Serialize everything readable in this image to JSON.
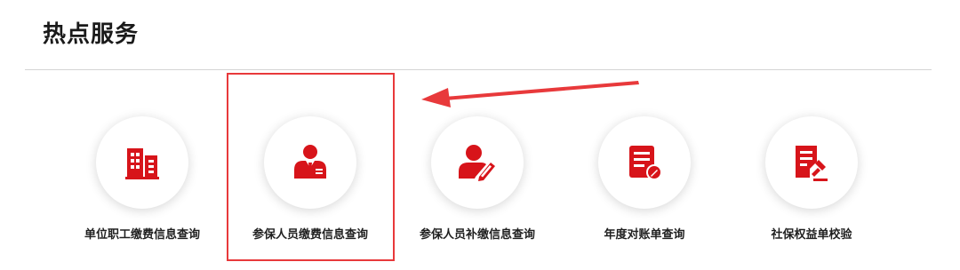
{
  "section": {
    "title": "热点服务"
  },
  "services": [
    {
      "label": "单位职工缴费信息查询",
      "icon": "buildings-icon"
    },
    {
      "label": "参保人员缴费信息查询",
      "icon": "person-id-icon"
    },
    {
      "label": "参保人员补缴信息查询",
      "icon": "person-edit-icon"
    },
    {
      "label": "年度对账单查询",
      "icon": "document-edit-icon"
    },
    {
      "label": "社保权益单校验",
      "icon": "document-stamp-icon"
    }
  ],
  "colors": {
    "accent": "#d7141a",
    "annotation": "#e8393b",
    "divider": "#d4d4d4",
    "title": "#1a1a1a"
  }
}
